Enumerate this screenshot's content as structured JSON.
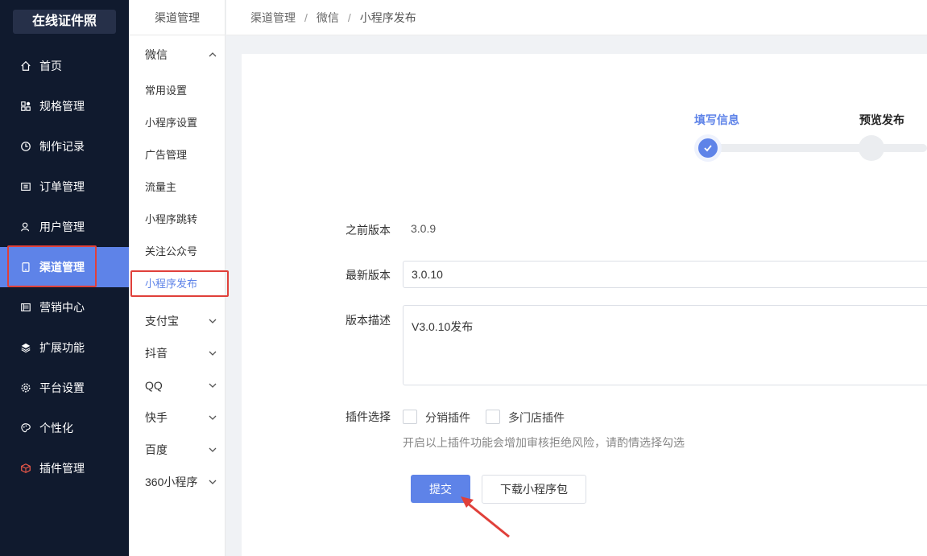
{
  "sidebar": {
    "logo": "在线证件照",
    "items": [
      {
        "label": "首页",
        "icon": "home-icon"
      },
      {
        "label": "规格管理",
        "icon": "grid-icon"
      },
      {
        "label": "制作记录",
        "icon": "clock-icon"
      },
      {
        "label": "订单管理",
        "icon": "list-icon"
      },
      {
        "label": "用户管理",
        "icon": "user-icon"
      },
      {
        "label": "渠道管理",
        "icon": "tablet-icon",
        "active": true
      },
      {
        "label": "营销中心",
        "icon": "marketing-icon"
      },
      {
        "label": "扩展功能",
        "icon": "layers-icon"
      },
      {
        "label": "平台设置",
        "icon": "gear-icon"
      },
      {
        "label": "个性化",
        "icon": "palette-icon"
      },
      {
        "label": "插件管理",
        "icon": "plugin-icon"
      }
    ]
  },
  "submenu": {
    "title": "渠道管理",
    "wechat_label": "微信",
    "wechat_items": [
      "常用设置",
      "小程序设置",
      "广告管理",
      "流量主",
      "小程序跳转",
      "关注公众号",
      "小程序发布"
    ],
    "active_item": "小程序发布",
    "groups": [
      "支付宝",
      "抖音",
      "QQ",
      "快手",
      "百度",
      "360小程序"
    ]
  },
  "breadcrumb": [
    "渠道管理",
    "微信",
    "小程序发布"
  ],
  "breadcrumb_sep": "/",
  "steps": [
    {
      "label": "填写信息",
      "status": "done"
    },
    {
      "label": "预览发布",
      "status": "pending"
    }
  ],
  "form": {
    "prev_version_label": "之前版本",
    "prev_version_value": "3.0.9",
    "latest_version_label": "最新版本",
    "latest_version_value": "3.0.10",
    "desc_label": "版本描述",
    "desc_value": "V3.0.10发布",
    "plugin_label": "插件选择",
    "plugins": [
      "分销插件",
      "多门店插件"
    ],
    "plugin_tip": "开启以上插件功能会增加审核拒绝风险，请酌情选择勾选",
    "submit_label": "提交",
    "download_label": "下载小程序包"
  },
  "colors": {
    "sidebar_bg": "#101a2e",
    "accent": "#5e83e8",
    "highlight": "#e0403a"
  }
}
